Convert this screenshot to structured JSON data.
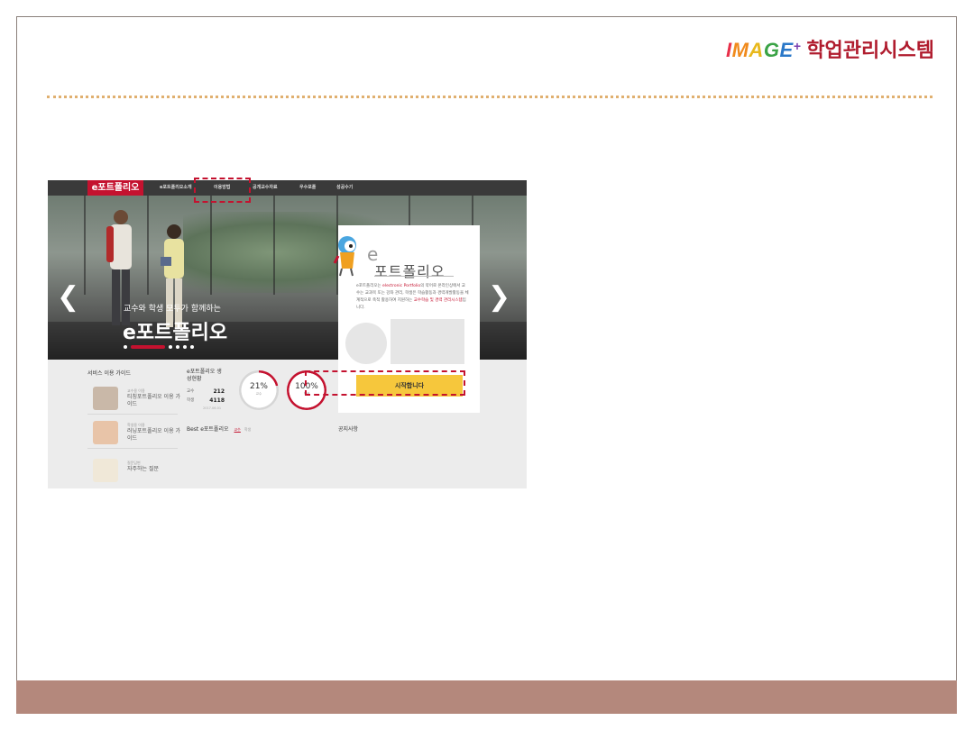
{
  "header": {
    "brand_latin": [
      "I",
      "M",
      "A",
      "G",
      "E",
      "+"
    ],
    "brand_korean": "학업관리시스템"
  },
  "site": {
    "logo": "e포트폴리오",
    "menu": [
      "e포트폴리오소개",
      "이용방법",
      "공개교수자료",
      "우수포폴",
      "성공수기"
    ],
    "hero_subtitle": "교수와 학생 모두가 함께하는",
    "hero_title": "e포트폴리오",
    "carousel_slides": 6,
    "card": {
      "e_mark": "e",
      "title": "포트폴리오",
      "desc_prefix": "e포트폴리오는 ",
      "desc_highlight": "electronic Portfolio",
      "desc_middle": "의 약어로 온라인상에서 교수는 교과목 또는 강좌 관리, 학생은 학습활동과 경력개발활동을 체계적으로 축적 활용하여 지원하는 ",
      "desc_highlight2": "교수학습 및 경력 관리시스템",
      "desc_suffix": "입니다.",
      "start_button": "시작합니다"
    },
    "guide": {
      "title": "서비스 이용 가이드",
      "items": [
        {
          "small": "교수용 이용",
          "label": "티칭포트폴리오 이용 가이드"
        },
        {
          "small": "학생용 이용",
          "label": "러닝포트폴리오 이용 가이드"
        },
        {
          "small": "질문답변",
          "label": "자주하는 질문"
        }
      ]
    },
    "stats": {
      "title": "e포트폴리오 생성현황",
      "rows": [
        {
          "label": "교수",
          "value": "212"
        },
        {
          "label": "학생",
          "value": "4118"
        }
      ],
      "date": "2017.06.01",
      "rings": [
        {
          "value_label": "21%",
          "sub": "교수",
          "fraction": 0.21
        },
        {
          "value_label": "100%",
          "sub": "학생",
          "fraction": 1.0
        }
      ]
    },
    "best": {
      "title": "Best e포트폴리오",
      "tab1": "교수",
      "tab2": "학생"
    },
    "notice_title": "공지사항"
  },
  "colors": {
    "accent_red": "#c4122f",
    "button_yellow": "#f6c73c",
    "footer_band": "#b4887c",
    "dotted_rule": "#e0b070"
  }
}
